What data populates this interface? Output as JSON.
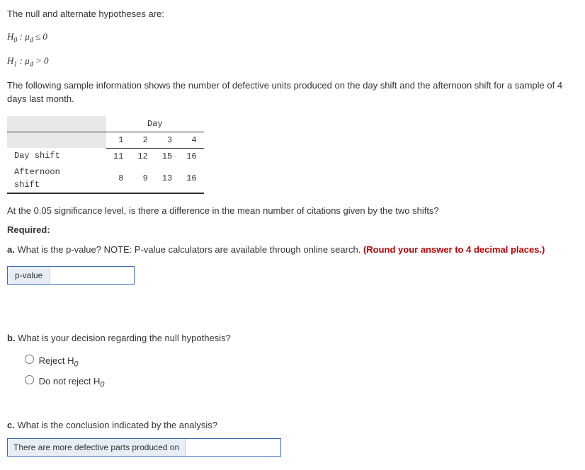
{
  "intro_text": "The null and alternate hypotheses are:",
  "h0": "H₀ : μ_d ≤ 0",
  "h1": "H₁ : μ_d > 0",
  "sample_text": "The following sample information shows the number of defective units produced on the day shift and the afternoon shift for a sample of 4 days last month.",
  "table": {
    "group_header": "Day",
    "col_headers": [
      "1",
      "2",
      "3",
      "4"
    ],
    "rows": [
      {
        "label": "Day shift",
        "vals": [
          "11",
          "12",
          "15",
          "16"
        ]
      },
      {
        "label": "Afternoon shift",
        "vals": [
          "8",
          "9",
          "13",
          "16"
        ]
      }
    ]
  },
  "question_lead": "At the 0.05 significance level, is there a difference in the mean number of citations given by the two shifts?",
  "required_label": "Required:",
  "part_a_prefix": "a.",
  "part_a_text": " What is the p-value? NOTE: P-value calculators are available through online search. ",
  "part_a_note": "(Round your answer to 4 decimal places.)",
  "pvalue_label": "p-value",
  "part_b_prefix": "b.",
  "part_b_text": " What is your decision regarding the null hypothesis?",
  "radios": {
    "reject": "Reject H",
    "reject_sub": "0",
    "donot": "Do not reject H",
    "donot_sub": "0"
  },
  "part_c_prefix": "c.",
  "part_c_text": " What is the conclusion indicated by the analysis?",
  "conclusion_label": "There are more defective parts produced on"
}
